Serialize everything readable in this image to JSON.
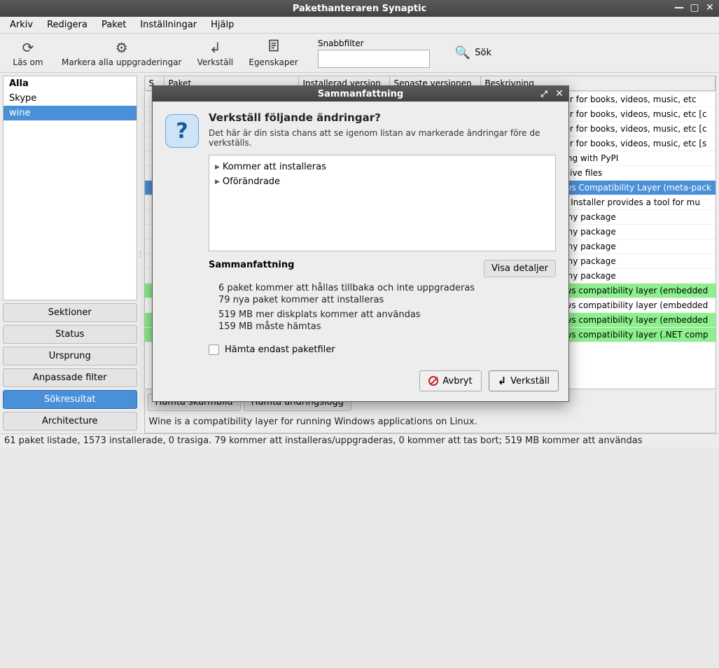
{
  "window": {
    "title": "Pakethanteraren Synaptic"
  },
  "menu": {
    "file": "Arkiv",
    "edit": "Redigera",
    "package": "Paket",
    "settings": "Inställningar",
    "help": "Hjälp"
  },
  "toolbar": {
    "reload": "Läs om",
    "mark_all": "Markera alla uppgraderingar",
    "apply": "Verkställ",
    "properties": "Egenskaper",
    "quick_filter_label": "Snabbfilter",
    "quick_filter_value": "",
    "search": "Sök"
  },
  "left_categories": {
    "all": "Alla",
    "skype": "Skype",
    "wine": "wine"
  },
  "left_buttons": {
    "sections": "Sektioner",
    "status": "Status",
    "origin": "Ursprung",
    "custom": "Anpassade filter",
    "results": "Sökresultat",
    "architecture": "Architecture"
  },
  "columns": {
    "s": "S",
    "package": "Paket",
    "installed": "Installerad version",
    "latest": "Senaste versionen",
    "desc": "Beskrivning"
  },
  "packages": [
    {
      "desc": "er for books, videos, music, etc",
      "class": ""
    },
    {
      "desc": "er for books, videos, music, etc [c",
      "class": ""
    },
    {
      "desc": "er for books, videos, music, etc [c",
      "class": ""
    },
    {
      "desc": "er for books, videos, music, etc [s",
      "class": ""
    },
    {
      "desc": "ing with PyPI",
      "class": ""
    },
    {
      "desc": "hive files",
      "class": ""
    },
    {
      "desc": "ws Compatibility Layer (meta-pack",
      "class": "sel"
    },
    {
      "desc": "r Installer provides a tool for mu",
      "class": ""
    },
    {
      "desc": "my package",
      "class": ""
    },
    {
      "desc": "my package",
      "class": ""
    },
    {
      "desc": "my package",
      "class": ""
    },
    {
      "desc": "my package",
      "class": ""
    },
    {
      "desc": "my package",
      "class": ""
    },
    {
      "desc": "ws compatibility layer (embedded",
      "class": "green"
    },
    {
      "desc": "ws compatibility layer (embedded",
      "class": ""
    },
    {
      "desc": "ws compatibility layer (embedded",
      "class": "green"
    },
    {
      "desc": "ws compatibility layer (.NET comp",
      "class": "green"
    }
  ],
  "bottom_buttons": {
    "screenshot": "Hämta skärmbild",
    "changelog": "Hämta ändringslogg"
  },
  "description": "Wine is a compatibility layer for running Windows applications on Linux.",
  "statusbar": "61 paket listade, 1573 installerade, 0 trasiga. 79 kommer att installeras/uppgraderas, 0 kommer att tas bort; 519 MB kommer att användas",
  "dialog": {
    "title": "Sammanfattning",
    "heading": "Verkställ följande ändringar?",
    "subtitle": "Det här är din sista chans att se igenom listan av markerade ändringar före de verkställs.",
    "tree": {
      "to_install": "Kommer att installeras",
      "unchanged": "Oförändrade"
    },
    "summary_label": "Sammanfattning",
    "details_btn": "Visa detaljer",
    "line1": "6 paket kommer att hållas tillbaka och inte uppgraderas",
    "line2": "79 nya paket kommer att installeras",
    "line3": "519 MB mer diskplats kommer att användas",
    "line4": "159 MB måste hämtas",
    "download_only": "Hämta endast paketfiler",
    "cancel": "Avbryt",
    "apply": "Verkställ"
  }
}
